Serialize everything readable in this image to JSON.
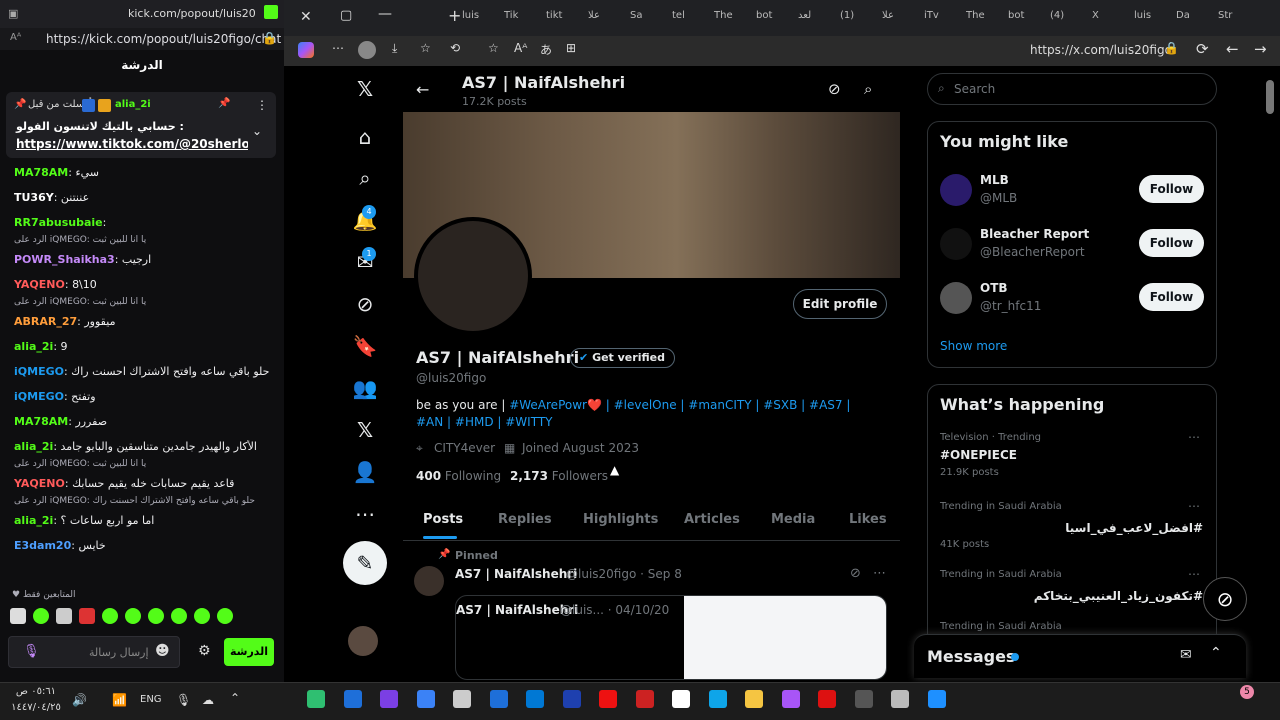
{
  "kick": {
    "tab_title": "kick.com/popout/luis20fi...",
    "url": "https://kick.com/popout/luis20figo/chat",
    "panel_title": "الدرشة",
    "pinned_by": "أرسلت من قبل",
    "pinned_user": "alia_2i",
    "pinned_text": "حسابي بالتيك لاتنسون الفولو :",
    "pinned_link": "https://www.tiktok.com/@20sherlock...",
    "messages": [
      {
        "user": "MA78AM",
        "text": "سيء",
        "color": "#53fc18"
      },
      {
        "user": "TU36Y",
        "text": "عننتنن",
        "color": "#ffffff"
      },
      {
        "user": "RR7abusubaie",
        "text": "",
        "color": "#53fc18"
      },
      {
        "reply": "الرد على iQMEGO: يا انا للبين ثبت",
        "user": "POWR_Shaikha3",
        "text": "ارجيب",
        "color": "#c58af9"
      },
      {
        "user": "YAQENO",
        "text": "8\\10",
        "color": "#ff5a5a"
      },
      {
        "reply": "الرد على iQMEGO: يا انا للبين ثبت",
        "user": "ABRAR_27",
        "text": "ميقوور",
        "color": "#ff9d3b"
      },
      {
        "user": "alia_2i",
        "text": "9",
        "color": "#53fc18"
      },
      {
        "user": "iQMEGO",
        "text": "حلو باقي ساعه وافتح الاشتراك احسنت راك",
        "color": "#1d9bf0"
      },
      {
        "user": "iQMEGO",
        "text": "وتفتح",
        "color": "#1d9bf0"
      },
      {
        "user": "MA78AM",
        "text": "صفررر",
        "color": "#53fc18"
      },
      {
        "user": "alia_2i",
        "text": "الأكار والهيدر جامدين متناسقين والبايو جامد",
        "color": "#53fc18"
      },
      {
        "reply": "الرد على iQMEGO: يا انا للبين ثبت",
        "user": "YAQENO",
        "text": "قاعد يقيم حسابات خله يقيم حسابك",
        "color": "#ff5a5a"
      },
      {
        "reply": "الرد على iQMEGO: حلو باقي ساعه وافتح الاشتراك احسنت راك",
        "user": "alia_2i",
        "text": "اما مو اربع ساعات ؟",
        "color": "#53fc18"
      },
      {
        "user": "E3dam20",
        "text": "خايس",
        "color": "#4e9fff"
      }
    ],
    "emote_section": "المتابعين فقط",
    "input_placeholder": "إرسال رسالة",
    "send_label": "الدرشة"
  },
  "browser": {
    "tabs": [
      "luis",
      "Tik",
      "tikt",
      "علا",
      "Sa",
      "tel",
      "The",
      "bot",
      "لعد",
      "(1)",
      "علا",
      "iTv",
      "The",
      "bot",
      "(4)",
      "X",
      "luis",
      "Da",
      "Str"
    ],
    "url": "https://x.com/luis20figo"
  },
  "profile": {
    "name": "AS7 | NaifAlshehri",
    "posts_count": "17.2K posts",
    "handle": "@luis20figo",
    "edit_label": "Edit profile",
    "verify_label": "Get verified",
    "bio_prefix": "be as you are |",
    "bio_tags": "#WeArePowr❤️ | #levelOne | #manCITY | #SXB | #AS7 | #AN | #HMD | #WITTY",
    "location": "CITY4ever",
    "joined": "Joined August 2023",
    "following_count": "400",
    "following_label": "Following",
    "followers_count": "2,173",
    "followers_label": "Followers",
    "tabs": [
      "Posts",
      "Replies",
      "Highlights",
      "Articles",
      "Media",
      "Likes"
    ],
    "pinned_label": "Pinned",
    "post_name": "AS7 | NaifAlshehri",
    "post_meta": "@luis20figo · Sep 8",
    "quote_name": "AS7 | NaifAlshehri",
    "quote_meta": "@luis... · 04/10/20"
  },
  "sidebar": {
    "search_placeholder": "Search",
    "might_like_title": "You might like",
    "suggestions": [
      {
        "name": "MLB",
        "handle": "@MLB",
        "follow": "Follow"
      },
      {
        "name": "Bleacher Report",
        "handle": "@BleacherReport",
        "follow": "Follow"
      },
      {
        "name": "OTB",
        "handle": "@tr_hfc11",
        "follow": "Follow"
      }
    ],
    "show_more": "Show more",
    "happening_title": "What’s happening",
    "trends": [
      {
        "context": "Television · Trending",
        "name": "#ONEPIECE",
        "posts": "21.9K posts"
      },
      {
        "context": "Trending in Saudi Arabia",
        "name": "#افضل_لاعب_في_اسيا",
        "posts": "41K posts"
      },
      {
        "context": "Trending in Saudi Arabia",
        "name": "#تكفون_زياد_العنيبي_بتخاكم",
        "posts": ""
      },
      {
        "context": "Trending in Saudi Arabia",
        "name": "",
        "posts": ""
      }
    ],
    "messages_label": "Messages"
  },
  "nav_badges": {
    "notifications": "4",
    "messages": "1"
  },
  "taskbar": {
    "time": "٠٥:٦١ ص",
    "date": "١٤٤٧/٠٤/٢٥",
    "lang": "ENG",
    "notif_count": "5"
  }
}
